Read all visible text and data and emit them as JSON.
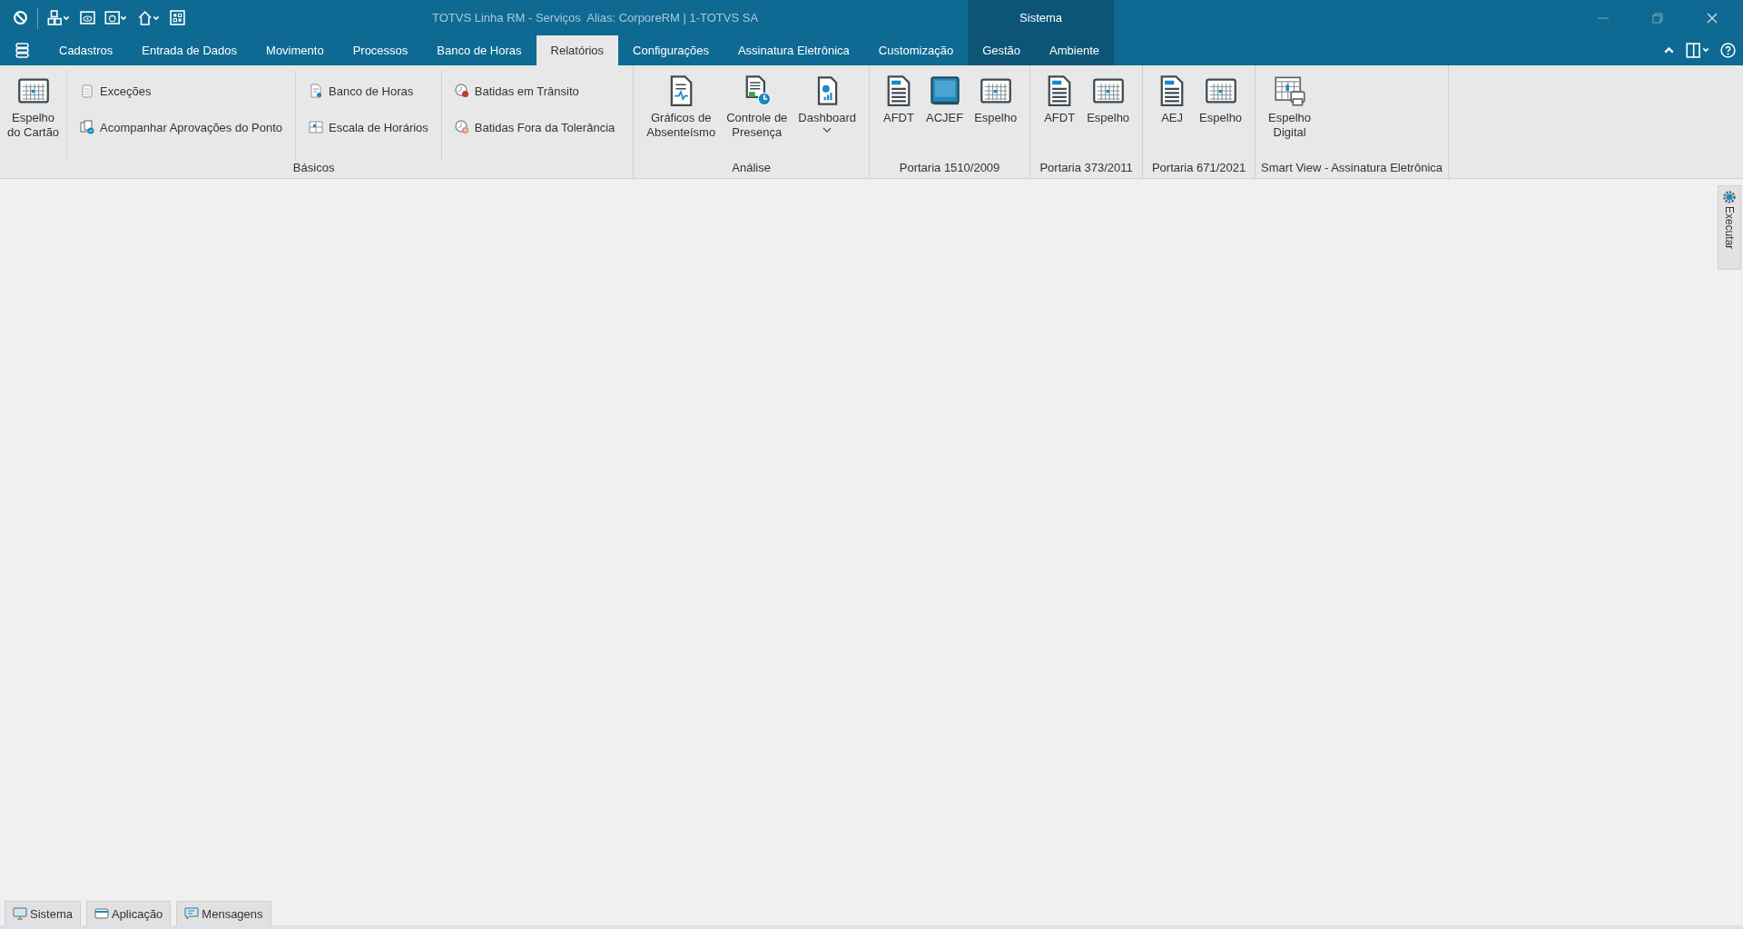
{
  "window": {
    "title": "TOTVS Linha RM - Serviços  Alias: CorporeRM | 1-TOTVS SA"
  },
  "context_tab_group": {
    "label": "Sistema"
  },
  "tabs": [
    {
      "label": "Cadastros",
      "selected": false,
      "contextual": false
    },
    {
      "label": "Entrada de Dados",
      "selected": false,
      "contextual": false
    },
    {
      "label": "Movimento",
      "selected": false,
      "contextual": false
    },
    {
      "label": "Processos",
      "selected": false,
      "contextual": false
    },
    {
      "label": "Banco de Horas",
      "selected": false,
      "contextual": false
    },
    {
      "label": "Relatórios",
      "selected": true,
      "contextual": false
    },
    {
      "label": "Configurações",
      "selected": false,
      "contextual": false
    },
    {
      "label": "Assinatura Eletrônica",
      "selected": false,
      "contextual": false
    },
    {
      "label": "Customização",
      "selected": false,
      "contextual": false
    },
    {
      "label": "Gestão",
      "selected": false,
      "contextual": true
    },
    {
      "label": "Ambiente",
      "selected": false,
      "contextual": true
    }
  ],
  "ribbon": {
    "groups": [
      {
        "label": "Básicos",
        "sections": [
          {
            "kind": "large",
            "items": [
              {
                "lines": [
                  "Espelho",
                  "do Cartão"
                ],
                "dropdown": false
              }
            ]
          },
          {
            "kind": "small",
            "items": [
              {
                "label": "Exceções"
              },
              {
                "label": "Acompanhar Aprovações do Ponto"
              }
            ]
          },
          {
            "kind": "small",
            "items": [
              {
                "label": "Banco de Horas"
              },
              {
                "label": "Escala de Horários"
              }
            ]
          },
          {
            "kind": "small",
            "items": [
              {
                "label": "Batidas em Trânsito"
              },
              {
                "label": "Batidas Fora da Tolerância"
              }
            ]
          }
        ]
      },
      {
        "label": "Análise",
        "sections": [
          {
            "kind": "large",
            "items": [
              {
                "lines": [
                  "Gráficos de",
                  "Absenteísmo"
                ],
                "dropdown": false
              },
              {
                "lines": [
                  "Controle de",
                  "Presença"
                ],
                "dropdown": false
              },
              {
                "lines": [
                  "Dashboard"
                ],
                "dropdown": true
              }
            ]
          }
        ]
      },
      {
        "label": "Portaria 1510/2009",
        "sections": [
          {
            "kind": "large",
            "items": [
              {
                "lines": [
                  "AFDT"
                ],
                "dropdown": false
              },
              {
                "lines": [
                  "ACJEF"
                ],
                "dropdown": false
              },
              {
                "lines": [
                  "Espelho"
                ],
                "dropdown": false
              }
            ]
          }
        ]
      },
      {
        "label": "Portaria 373/2011",
        "sections": [
          {
            "kind": "large",
            "items": [
              {
                "lines": [
                  "AFDT"
                ],
                "dropdown": false
              },
              {
                "lines": [
                  "Espelho"
                ],
                "dropdown": false
              }
            ]
          }
        ]
      },
      {
        "label": "Portaria 671/2021",
        "sections": [
          {
            "kind": "large",
            "items": [
              {
                "lines": [
                  "AEJ"
                ],
                "dropdown": false
              },
              {
                "lines": [
                  "Espelho"
                ],
                "dropdown": false
              }
            ]
          }
        ]
      },
      {
        "label": "Smart View - Assinatura Eletrônica",
        "sections": [
          {
            "kind": "large",
            "items": [
              {
                "lines": [
                  "Espelho",
                  "Digital"
                ],
                "dropdown": false
              }
            ]
          }
        ]
      }
    ]
  },
  "side_panel": {
    "label": "Executar"
  },
  "bottom_tabs": [
    {
      "label": "Sistema"
    },
    {
      "label": "Aplicação"
    },
    {
      "label": "Mensagens"
    }
  ]
}
